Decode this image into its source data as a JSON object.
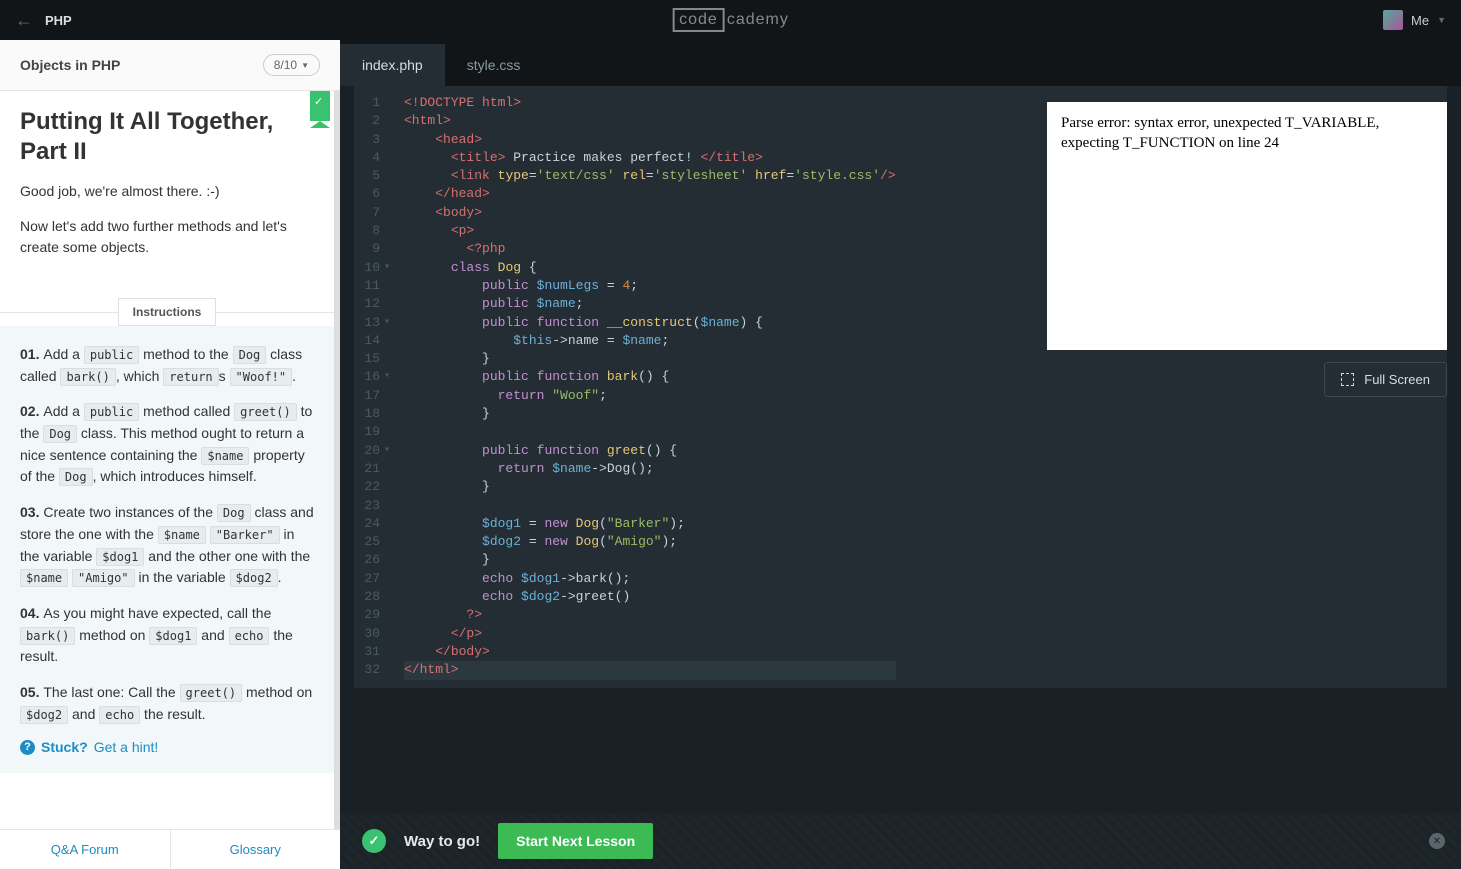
{
  "header": {
    "language": "PHP",
    "logo_boxed": "code",
    "logo_rest": "cademy",
    "me_label": "Me"
  },
  "lesson": {
    "category": "Objects in PHP",
    "step": "8/10",
    "title": "Putting It All Together, Part II",
    "paragraphs": [
      "Good job, we're almost there. :-)",
      "Now let's add two further methods and let's create some objects."
    ],
    "instructions_label": "Instructions",
    "steps": [
      {
        "num": "01.",
        "parts": [
          {
            "t": "Add a "
          },
          {
            "c": "public"
          },
          {
            "t": " method to the "
          },
          {
            "c": "Dog"
          },
          {
            "t": " class called "
          },
          {
            "c": "bark()"
          },
          {
            "t": ", which "
          },
          {
            "c": "return"
          },
          {
            "t": "s "
          },
          {
            "c": "\"Woof!\""
          },
          {
            "t": "."
          }
        ]
      },
      {
        "num": "02.",
        "parts": [
          {
            "t": "Add a "
          },
          {
            "c": "public"
          },
          {
            "t": " method called "
          },
          {
            "c": "greet()"
          },
          {
            "t": " to the "
          },
          {
            "c": "Dog"
          },
          {
            "t": " class. This method ought to return a nice sentence containing the "
          },
          {
            "c": "$name"
          },
          {
            "t": " property of the "
          },
          {
            "c": "Dog"
          },
          {
            "t": ", which introduces himself."
          }
        ]
      },
      {
        "num": "03.",
        "parts": [
          {
            "t": "Create two instances of the "
          },
          {
            "c": "Dog"
          },
          {
            "t": " class and store the one with the "
          },
          {
            "c": "$name"
          },
          {
            "t": " "
          },
          {
            "c": "\"Barker\""
          },
          {
            "t": " in the variable "
          },
          {
            "c": "$dog1"
          },
          {
            "t": " and the other one with the "
          },
          {
            "c": "$name"
          },
          {
            "t": " "
          },
          {
            "c": "\"Amigo\""
          },
          {
            "t": " in the variable "
          },
          {
            "c": "$dog2"
          },
          {
            "t": "."
          }
        ]
      },
      {
        "num": "04.",
        "parts": [
          {
            "t": "As you might have expected, call the "
          },
          {
            "c": "bark()"
          },
          {
            "t": " method on "
          },
          {
            "c": "$dog1"
          },
          {
            "t": " and "
          },
          {
            "c": "echo"
          },
          {
            "t": " the result."
          }
        ]
      },
      {
        "num": "05.",
        "parts": [
          {
            "t": "The last one: Call the "
          },
          {
            "c": "greet()"
          },
          {
            "t": " method on "
          },
          {
            "c": "$dog2"
          },
          {
            "t": " and "
          },
          {
            "c": "echo"
          },
          {
            "t": " the result."
          }
        ]
      }
    ],
    "stuck_label": "Stuck?",
    "hint_link": "Get a hint!",
    "bottom_links": [
      "Q&A Forum",
      "Glossary"
    ]
  },
  "editor": {
    "tabs": [
      "index.php",
      "style.css"
    ],
    "active_tab": 0,
    "lines": [
      {
        "n": "1",
        "fold": false,
        "tokens": [
          {
            "c": "t-tag",
            "s": "<!DOCTYPE html>"
          }
        ]
      },
      {
        "n": "2",
        "fold": false,
        "tokens": [
          {
            "c": "t-tag",
            "s": "<html>"
          }
        ]
      },
      {
        "n": "3",
        "fold": false,
        "tokens": [
          {
            "c": "",
            "s": "    "
          },
          {
            "c": "t-tag",
            "s": "<head>"
          }
        ]
      },
      {
        "n": "4",
        "fold": false,
        "tokens": [
          {
            "c": "",
            "s": "      "
          },
          {
            "c": "t-tag",
            "s": "<title>"
          },
          {
            "c": "",
            "s": " Practice makes perfect! "
          },
          {
            "c": "t-tag",
            "s": "</title>"
          }
        ]
      },
      {
        "n": "5",
        "fold": false,
        "tokens": [
          {
            "c": "",
            "s": "      "
          },
          {
            "c": "t-tag",
            "s": "<link"
          },
          {
            "c": "",
            "s": " "
          },
          {
            "c": "t-attr",
            "s": "type"
          },
          {
            "c": "",
            "s": "="
          },
          {
            "c": "t-str",
            "s": "'text/css'"
          },
          {
            "c": "",
            "s": " "
          },
          {
            "c": "t-attr",
            "s": "rel"
          },
          {
            "c": "",
            "s": "="
          },
          {
            "c": "t-str",
            "s": "'stylesheet'"
          },
          {
            "c": "",
            "s": " "
          },
          {
            "c": "t-attr",
            "s": "href"
          },
          {
            "c": "",
            "s": "="
          },
          {
            "c": "t-str",
            "s": "'style.css'"
          },
          {
            "c": "t-tag",
            "s": "/>"
          }
        ]
      },
      {
        "n": "6",
        "fold": false,
        "tokens": [
          {
            "c": "",
            "s": "    "
          },
          {
            "c": "t-tag",
            "s": "</head>"
          }
        ]
      },
      {
        "n": "7",
        "fold": false,
        "tokens": [
          {
            "c": "",
            "s": "    "
          },
          {
            "c": "t-tag",
            "s": "<body>"
          }
        ]
      },
      {
        "n": "8",
        "fold": false,
        "tokens": [
          {
            "c": "",
            "s": "      "
          },
          {
            "c": "t-tag",
            "s": "<p>"
          }
        ]
      },
      {
        "n": "9",
        "fold": false,
        "tokens": [
          {
            "c": "",
            "s": "        "
          },
          {
            "c": "t-phpopen",
            "s": "<?php"
          }
        ]
      },
      {
        "n": "10",
        "fold": true,
        "tokens": [
          {
            "c": "",
            "s": "      "
          },
          {
            "c": "t-kw",
            "s": "class"
          },
          {
            "c": "",
            "s": " "
          },
          {
            "c": "t-const",
            "s": "Dog"
          },
          {
            "c": "",
            "s": " {"
          }
        ]
      },
      {
        "n": "11",
        "fold": false,
        "tokens": [
          {
            "c": "",
            "s": "          "
          },
          {
            "c": "t-kw",
            "s": "public"
          },
          {
            "c": "",
            "s": " "
          },
          {
            "c": "t-var",
            "s": "$numLegs"
          },
          {
            "c": "",
            "s": " = "
          },
          {
            "c": "t-num",
            "s": "4"
          },
          {
            "c": "",
            "s": ";"
          }
        ]
      },
      {
        "n": "12",
        "fold": false,
        "tokens": [
          {
            "c": "",
            "s": "          "
          },
          {
            "c": "t-kw",
            "s": "public"
          },
          {
            "c": "",
            "s": " "
          },
          {
            "c": "t-var",
            "s": "$name"
          },
          {
            "c": "",
            "s": ";"
          }
        ]
      },
      {
        "n": "13",
        "fold": true,
        "tokens": [
          {
            "c": "",
            "s": "          "
          },
          {
            "c": "t-kw",
            "s": "public"
          },
          {
            "c": "",
            "s": " "
          },
          {
            "c": "t-kw",
            "s": "function"
          },
          {
            "c": "",
            "s": " "
          },
          {
            "c": "t-fn",
            "s": "__construct"
          },
          {
            "c": "",
            "s": "("
          },
          {
            "c": "t-var",
            "s": "$name"
          },
          {
            "c": "",
            "s": ") {"
          }
        ]
      },
      {
        "n": "14",
        "fold": false,
        "tokens": [
          {
            "c": "",
            "s": "              "
          },
          {
            "c": "t-var",
            "s": "$this"
          },
          {
            "c": "",
            "s": "->name = "
          },
          {
            "c": "t-var",
            "s": "$name"
          },
          {
            "c": "",
            "s": ";"
          }
        ]
      },
      {
        "n": "15",
        "fold": false,
        "tokens": [
          {
            "c": "",
            "s": "          }"
          }
        ]
      },
      {
        "n": "16",
        "fold": true,
        "tokens": [
          {
            "c": "",
            "s": "          "
          },
          {
            "c": "t-kw",
            "s": "public"
          },
          {
            "c": "",
            "s": " "
          },
          {
            "c": "t-kw",
            "s": "function"
          },
          {
            "c": "",
            "s": " "
          },
          {
            "c": "t-fn",
            "s": "bark"
          },
          {
            "c": "",
            "s": "() {"
          }
        ]
      },
      {
        "n": "17",
        "fold": false,
        "tokens": [
          {
            "c": "",
            "s": "            "
          },
          {
            "c": "t-kw",
            "s": "return"
          },
          {
            "c": "",
            "s": " "
          },
          {
            "c": "t-str",
            "s": "\"Woof\""
          },
          {
            "c": "",
            "s": ";"
          }
        ]
      },
      {
        "n": "18",
        "fold": false,
        "tokens": [
          {
            "c": "",
            "s": "          }"
          }
        ]
      },
      {
        "n": "19",
        "fold": false,
        "tokens": [
          {
            "c": "",
            "s": "          "
          }
        ]
      },
      {
        "n": "20",
        "fold": true,
        "tokens": [
          {
            "c": "",
            "s": "          "
          },
          {
            "c": "t-kw",
            "s": "public"
          },
          {
            "c": "",
            "s": " "
          },
          {
            "c": "t-kw",
            "s": "function"
          },
          {
            "c": "",
            "s": " "
          },
          {
            "c": "t-fn",
            "s": "greet"
          },
          {
            "c": "",
            "s": "() {"
          }
        ]
      },
      {
        "n": "21",
        "fold": false,
        "tokens": [
          {
            "c": "",
            "s": "            "
          },
          {
            "c": "t-kw",
            "s": "return"
          },
          {
            "c": "",
            "s": " "
          },
          {
            "c": "t-var",
            "s": "$name"
          },
          {
            "c": "",
            "s": "->Dog();"
          }
        ]
      },
      {
        "n": "22",
        "fold": false,
        "tokens": [
          {
            "c": "",
            "s": "          }"
          }
        ]
      },
      {
        "n": "23",
        "fold": false,
        "tokens": [
          {
            "c": "",
            "s": "          "
          }
        ]
      },
      {
        "n": "24",
        "fold": false,
        "tokens": [
          {
            "c": "",
            "s": "          "
          },
          {
            "c": "t-var",
            "s": "$dog1"
          },
          {
            "c": "",
            "s": " = "
          },
          {
            "c": "t-kw",
            "s": "new"
          },
          {
            "c": "",
            "s": " "
          },
          {
            "c": "t-const",
            "s": "Dog"
          },
          {
            "c": "",
            "s": "("
          },
          {
            "c": "t-str",
            "s": "\"Barker\""
          },
          {
            "c": "",
            "s": ");"
          }
        ]
      },
      {
        "n": "25",
        "fold": false,
        "tokens": [
          {
            "c": "",
            "s": "          "
          },
          {
            "c": "t-var",
            "s": "$dog2"
          },
          {
            "c": "",
            "s": " = "
          },
          {
            "c": "t-kw",
            "s": "new"
          },
          {
            "c": "",
            "s": " "
          },
          {
            "c": "t-const",
            "s": "Dog"
          },
          {
            "c": "",
            "s": "("
          },
          {
            "c": "t-str",
            "s": "\"Amigo\""
          },
          {
            "c": "",
            "s": ");"
          }
        ]
      },
      {
        "n": "26",
        "fold": false,
        "tokens": [
          {
            "c": "",
            "s": "          }"
          }
        ]
      },
      {
        "n": "27",
        "fold": false,
        "tokens": [
          {
            "c": "",
            "s": "          "
          },
          {
            "c": "t-kw",
            "s": "echo"
          },
          {
            "c": "",
            "s": " "
          },
          {
            "c": "t-var",
            "s": "$dog1"
          },
          {
            "c": "",
            "s": "->bark();"
          }
        ]
      },
      {
        "n": "28",
        "fold": false,
        "tokens": [
          {
            "c": "",
            "s": "          "
          },
          {
            "c": "t-kw",
            "s": "echo"
          },
          {
            "c": "",
            "s": " "
          },
          {
            "c": "t-var",
            "s": "$dog2"
          },
          {
            "c": "",
            "s": "->greet()"
          }
        ]
      },
      {
        "n": "29",
        "fold": false,
        "tokens": [
          {
            "c": "",
            "s": "        "
          },
          {
            "c": "t-phpopen",
            "s": "?>"
          }
        ]
      },
      {
        "n": "30",
        "fold": false,
        "tokens": [
          {
            "c": "",
            "s": "      "
          },
          {
            "c": "t-tag",
            "s": "</p>"
          }
        ]
      },
      {
        "n": "31",
        "fold": false,
        "tokens": [
          {
            "c": "",
            "s": "    "
          },
          {
            "c": "t-tag",
            "s": "</body>"
          }
        ]
      },
      {
        "n": "32",
        "fold": false,
        "hl": true,
        "tokens": [
          {
            "c": "t-tag",
            "s": "</html>"
          }
        ]
      }
    ]
  },
  "output": {
    "text": "Parse error: syntax error, unexpected T_VARIABLE, expecting T_FUNCTION on line 24",
    "fullscreen_label": "Full Screen"
  },
  "footer": {
    "status": "Way to go!",
    "button": "Start Next Lesson"
  }
}
